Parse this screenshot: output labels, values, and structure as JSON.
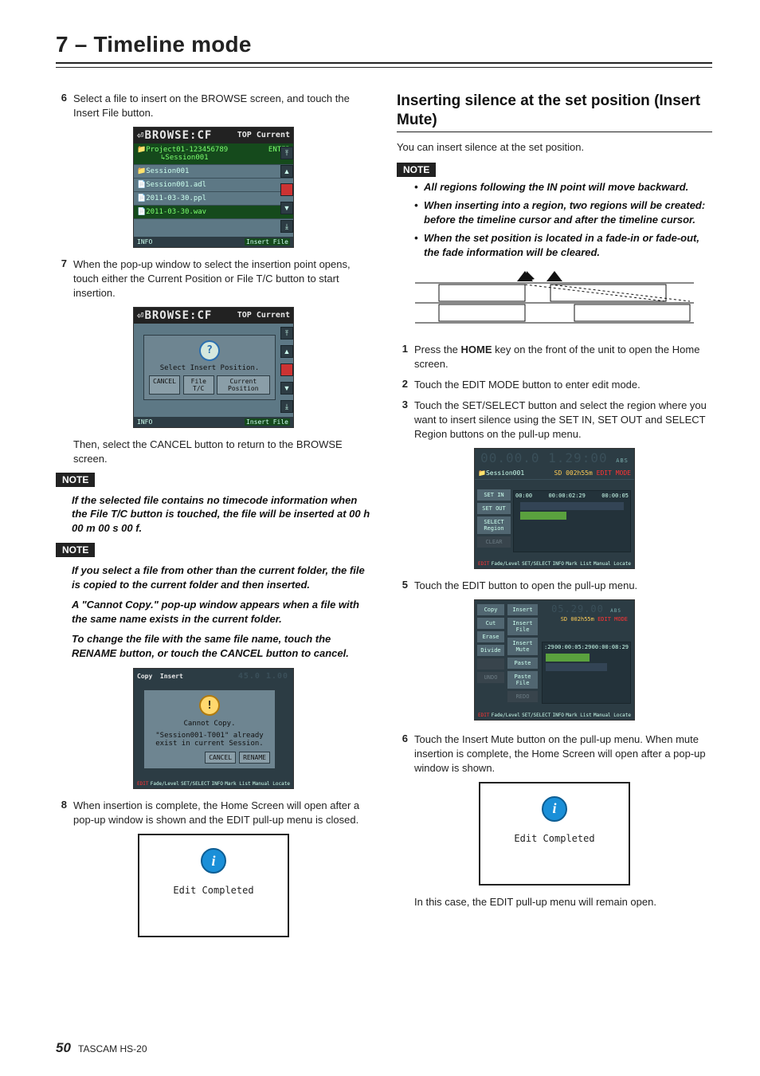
{
  "chapter": "7 – Timeline mode",
  "footer": {
    "page": "50",
    "product": "TASCAM HS-20"
  },
  "left": {
    "step6": {
      "num": "6",
      "text_a": "Select a file to insert on the BROWSE screen, and touch the ",
      "btn": "Insert File",
      "text_b": " button."
    },
    "browse1": {
      "title": "BROWSE:CF",
      "top": "TOP",
      "current": "Current",
      "path_a": "Project01-123456789",
      "path_b": "Session001",
      "enter": "ENTER",
      "rows": [
        "Session001",
        "Session001.adl",
        "2011-03-30.ppl",
        "2011-03-30.wav"
      ],
      "info": "INFO",
      "insert": "Insert File"
    },
    "step7": {
      "num": "7",
      "text": "When the pop-up window to select the insertion point opens, touch either the Current Position or File T/C button to start insertion."
    },
    "browse2": {
      "title": "BROWSE:CF",
      "top": "TOP",
      "current": "Current",
      "msg": "Select Insert Position.",
      "cancel": "CANCEL",
      "filetc": "File T/C",
      "curpos": "Current Position",
      "info": "INFO",
      "insert": "Insert File"
    },
    "then_text": "Then, select the CANCEL button to return to the BROWSE screen.",
    "note_label": "NOTE",
    "note1": "If the selected file contains no timecode information when the File T/C button is touched, the file will be inserted at 00 h 00 m 00 s 00 f.",
    "note2_p1": "If you select a file from other than the current folder, the file is copied to the current folder and then inserted.",
    "note2_p2": "A \"Cannot Copy.\" pop-up window appears when a file with the same name exists in the current folder.",
    "note2_p3": "To change the file with the same file name, touch the RENAME button, or touch the CANCEL button to cancel.",
    "cannotcopy": {
      "warn": "!",
      "title": "Cannot Copy.",
      "line": "\"Session001-T001\" already exist in current Session.",
      "cancel": "CANCEL",
      "rename": "RENAME",
      "menu": [
        "Copy",
        "Insert"
      ],
      "foot": [
        "EDIT",
        "Fade/Level",
        "SET/SELECT",
        "INFO",
        "Mark List",
        "Manual Locate"
      ]
    },
    "step8": {
      "num": "8",
      "text": "When insertion is complete, the Home Screen will open after a pop-up window is shown and the EDIT pull-up menu is closed."
    },
    "popup": "Edit Completed"
  },
  "right": {
    "heading": "Inserting silence at the set position (Insert Mute)",
    "intro": "You can insert silence at the set position.",
    "note_label": "NOTE",
    "bullets": [
      "All regions following the IN point will move backward.",
      "When inserting into a region, two regions will be created: before the timeline cursor and after the timeline cursor.",
      "When the set position is located in a fade-in or fade-out, the fade information will be cleared."
    ],
    "step1": {
      "num": "1",
      "a": "Press the ",
      "b": "HOME",
      "c": " key on the front of the unit to open the Home screen."
    },
    "step2": {
      "num": "2",
      "text": "Touch the EDIT MODE button to enter edit mode."
    },
    "step3": {
      "num": "3",
      "text": "Touch the SET/SELECT button and select the region where you want to insert silence using the SET IN, SET OUT and SELECT Region buttons on the pull-up menu."
    },
    "screen3": {
      "time": "00.00.0 1.29:00",
      "abs": "ABS",
      "sess": "Session001",
      "sd": "SD  002h55m",
      "mode": "EDIT MODE",
      "btns": [
        "SET IN",
        "SET OUT",
        "SELECT Region",
        "CLEAR"
      ],
      "tl": [
        "00:00",
        "00:00:02:29",
        "00:00:05"
      ],
      "foot": [
        "EDIT",
        "Fade/Level",
        "SET/SELECT",
        "INFO",
        "Mark List",
        "Manual Locate"
      ]
    },
    "step5": {
      "num": "5",
      "text": "Touch the EDIT button to open the pull-up menu."
    },
    "screen5": {
      "left": [
        "Copy",
        "Cut",
        "Erase",
        "Divide",
        "",
        "UNDO"
      ],
      "right": [
        "Insert",
        "Insert File",
        "Insert Mute",
        "Paste",
        "Paste File",
        "REDO"
      ],
      "time": "05.29.00",
      "abs": "ABS",
      "sd": "SD  002h55m",
      "mode": "EDIT MODE",
      "tl": [
        ":29",
        "00:00:05:29",
        "00:00:08:29"
      ],
      "foot": [
        "EDIT",
        "Fade/Level",
        "SET/SELECT",
        "INFO",
        "Mark List",
        "Manual Locate"
      ]
    },
    "step6": {
      "num": "6",
      "text": "Touch the Insert Mute button on the pull-up menu. When mute insertion is complete, the Home Screen will open after a pop-up window is shown."
    },
    "popup": "Edit Completed",
    "closing": "In this case, the EDIT pull-up menu will remain open."
  }
}
